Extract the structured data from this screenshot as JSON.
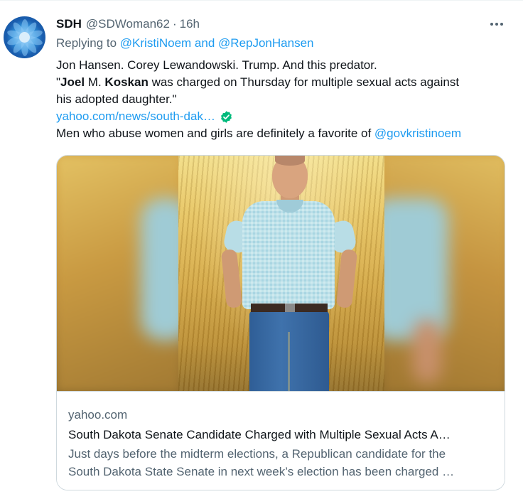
{
  "author": {
    "name": "SDH",
    "handle": "@SDWoman62",
    "separator": "·",
    "time": "16h",
    "avatar_icon": "blue-flower-avatar"
  },
  "reply": {
    "prefix": "Replying to",
    "mention_1": "@KristiNoem",
    "conjunction": "and",
    "mention_2": "@RepJonHansen"
  },
  "body": {
    "line_1": "Jon Hansen. Corey Lewandowski. Trump. And this predator.",
    "quote_open": "\"",
    "first_name": "Joel",
    "middle_initial": " M. ",
    "last_name": "Koskan",
    "quote_rest": " was charged on Thursday for multiple sexual acts against",
    "line_3": "his adopted daughter.\"",
    "url": "yahoo.com/news/south-dak…",
    "url_icon": "verified-check-icon",
    "line_5_text": "Men who abuse women and girls are definitely a favorite of ",
    "line_5_mention": "@govkristinoem"
  },
  "card": {
    "domain": "yahoo.com",
    "title": "South Dakota Senate Candidate Charged with Multiple Sexual Acts A…",
    "desc_line_1": "Just days before the midterm elections, a Republican candidate for the",
    "desc_line_2": "South Dakota State Senate in next week’s election has been charged …"
  },
  "colors": {
    "link": "#1d9bf0",
    "secondary_text": "#536471",
    "primary_text": "#0f1419",
    "verified_check": "#00ba7c",
    "border": "#cfd9de"
  },
  "icons": {
    "more": "more-options-icon"
  }
}
